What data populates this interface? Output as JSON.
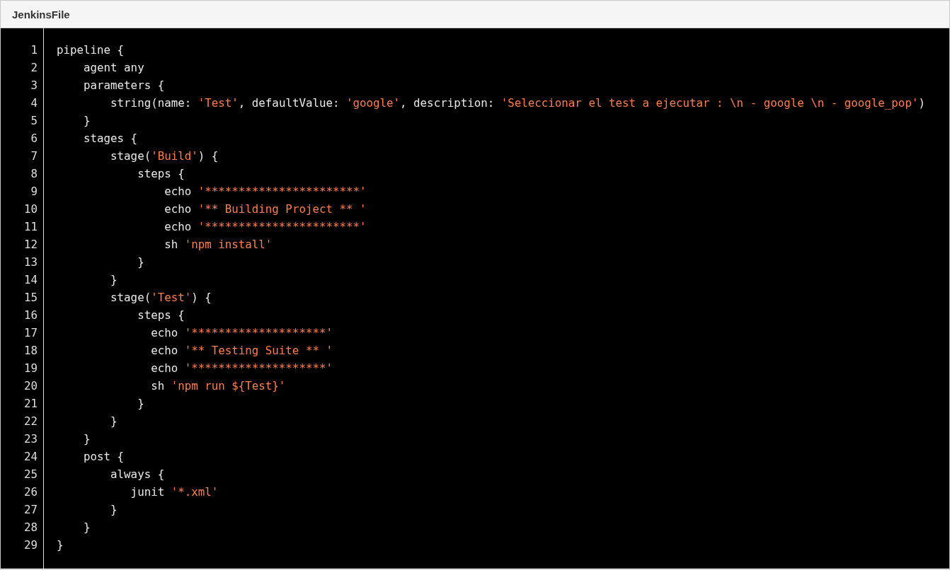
{
  "panel": {
    "title": "JenkinsFile"
  },
  "code": {
    "lines": [
      {
        "number": "1",
        "segments": [
          {
            "kind": "plain",
            "text": "pipeline {"
          }
        ]
      },
      {
        "number": "2",
        "segments": [
          {
            "kind": "plain",
            "text": "    agent any"
          }
        ]
      },
      {
        "number": "3",
        "segments": [
          {
            "kind": "plain",
            "text": "    parameters {"
          }
        ]
      },
      {
        "number": "4",
        "segments": [
          {
            "kind": "plain",
            "text": "        string(name: "
          },
          {
            "kind": "string",
            "text": "'Test'"
          },
          {
            "kind": "plain",
            "text": ", defaultValue: "
          },
          {
            "kind": "string",
            "text": "'google'"
          },
          {
            "kind": "plain",
            "text": ", description: "
          },
          {
            "kind": "string",
            "text": "'Seleccionar el test a ejecutar : \\n - google \\n - google_pop'"
          },
          {
            "kind": "plain",
            "text": ")"
          }
        ]
      },
      {
        "number": "5",
        "segments": [
          {
            "kind": "plain",
            "text": "    }"
          }
        ]
      },
      {
        "number": "6",
        "segments": [
          {
            "kind": "plain",
            "text": "    stages {"
          }
        ]
      },
      {
        "number": "7",
        "segments": [
          {
            "kind": "plain",
            "text": "        stage("
          },
          {
            "kind": "string",
            "text": "'Build'"
          },
          {
            "kind": "plain",
            "text": ") {"
          }
        ]
      },
      {
        "number": "8",
        "segments": [
          {
            "kind": "plain",
            "text": "            steps {"
          }
        ]
      },
      {
        "number": "9",
        "segments": [
          {
            "kind": "plain",
            "text": "                echo "
          },
          {
            "kind": "string",
            "text": "'***********************'"
          }
        ]
      },
      {
        "number": "10",
        "segments": [
          {
            "kind": "plain",
            "text": "                echo "
          },
          {
            "kind": "string",
            "text": "'** Building Project ** '"
          }
        ]
      },
      {
        "number": "11",
        "segments": [
          {
            "kind": "plain",
            "text": "                echo "
          },
          {
            "kind": "string",
            "text": "'***********************'"
          }
        ]
      },
      {
        "number": "12",
        "segments": [
          {
            "kind": "plain",
            "text": "                sh "
          },
          {
            "kind": "string",
            "text": "'npm install'"
          }
        ]
      },
      {
        "number": "13",
        "segments": [
          {
            "kind": "plain",
            "text": "            }"
          }
        ]
      },
      {
        "number": "14",
        "segments": [
          {
            "kind": "plain",
            "text": "        }"
          }
        ]
      },
      {
        "number": "15",
        "segments": [
          {
            "kind": "plain",
            "text": "        stage("
          },
          {
            "kind": "string",
            "text": "'Test'"
          },
          {
            "kind": "plain",
            "text": ") {"
          }
        ]
      },
      {
        "number": "16",
        "segments": [
          {
            "kind": "plain",
            "text": "            steps {"
          }
        ]
      },
      {
        "number": "17",
        "segments": [
          {
            "kind": "plain",
            "text": "              echo "
          },
          {
            "kind": "string",
            "text": "'********************'"
          }
        ]
      },
      {
        "number": "18",
        "segments": [
          {
            "kind": "plain",
            "text": "              echo "
          },
          {
            "kind": "string",
            "text": "'** Testing Suite ** '"
          }
        ]
      },
      {
        "number": "19",
        "segments": [
          {
            "kind": "plain",
            "text": "              echo "
          },
          {
            "kind": "string",
            "text": "'********************'"
          }
        ]
      },
      {
        "number": "20",
        "segments": [
          {
            "kind": "plain",
            "text": "              sh "
          },
          {
            "kind": "string",
            "text": "'npm run ${Test}'"
          }
        ]
      },
      {
        "number": "21",
        "segments": [
          {
            "kind": "plain",
            "text": "            }"
          }
        ]
      },
      {
        "number": "22",
        "segments": [
          {
            "kind": "plain",
            "text": "        }"
          }
        ]
      },
      {
        "number": "23",
        "segments": [
          {
            "kind": "plain",
            "text": "    }"
          }
        ]
      },
      {
        "number": "24",
        "segments": [
          {
            "kind": "plain",
            "text": "    post {"
          }
        ]
      },
      {
        "number": "25",
        "segments": [
          {
            "kind": "plain",
            "text": "        always {"
          }
        ]
      },
      {
        "number": "26",
        "segments": [
          {
            "kind": "plain",
            "text": "           junit "
          },
          {
            "kind": "string",
            "text": "'*.xml'"
          }
        ]
      },
      {
        "number": "27",
        "segments": [
          {
            "kind": "plain",
            "text": "        }"
          }
        ]
      },
      {
        "number": "28",
        "segments": [
          {
            "kind": "plain",
            "text": "    }"
          }
        ]
      },
      {
        "number": "29",
        "segments": [
          {
            "kind": "plain",
            "text": "}"
          }
        ]
      }
    ]
  }
}
